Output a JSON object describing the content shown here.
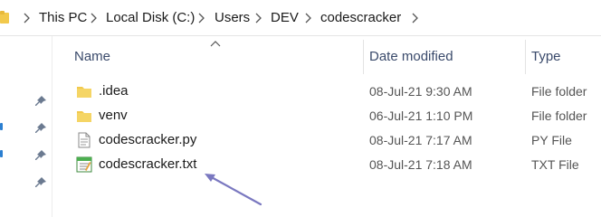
{
  "address_bar": {
    "crumbs": [
      "This PC",
      "Local Disk (C:)",
      "Users",
      "DEV",
      "codescracker"
    ]
  },
  "columns": {
    "name": "Name",
    "date": "Date modified",
    "type": "Type"
  },
  "files": [
    {
      "name": ".idea",
      "date": "08-Jul-21 9:30 AM",
      "type": "File folder",
      "icon": "folder-icon"
    },
    {
      "name": "venv",
      "date": "06-Jul-21 1:10 PM",
      "type": "File folder",
      "icon": "folder-icon"
    },
    {
      "name": "codescracker.py",
      "date": "08-Jul-21 7:17 AM",
      "type": "PY File",
      "icon": "python-file-icon"
    },
    {
      "name": "codescracker.txt",
      "date": "08-Jul-21 7:18 AM",
      "type": "TXT File",
      "icon": "text-file-icon"
    }
  ],
  "colors": {
    "folder": "#f2c94c",
    "annotation_arrow": "#7a78c0",
    "header_text": "#3a4a6b"
  }
}
